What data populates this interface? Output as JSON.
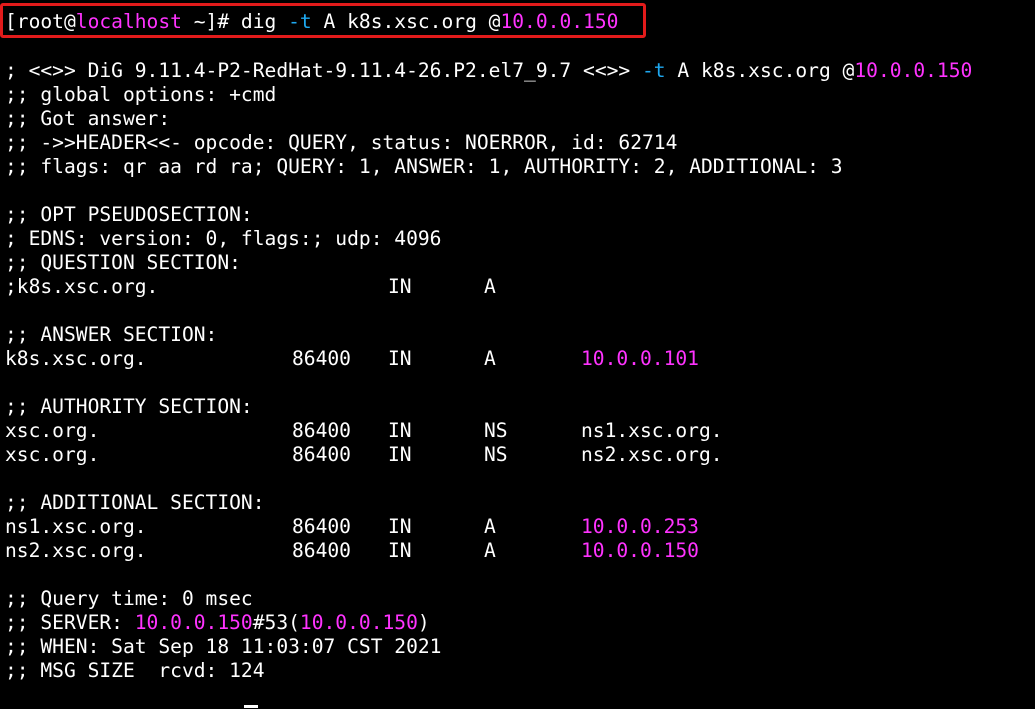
{
  "colors": {
    "background": "#000000",
    "foreground": "#ffffff",
    "magenta": "#ff33ff",
    "cyan": "#1ea8f0",
    "highlight_box": "#e21b1b"
  },
  "prompt": {
    "open": "[root@",
    "host": "localhost",
    "rest": " ~]# dig ",
    "flag": "-t",
    "args": " A k8s.xsc.org @",
    "server": "10.0.0.150"
  },
  "header": {
    "banner_pre": "; <<>> DiG 9.11.4-P2-RedHat-9.11.4-26.P2.el7_9.7 <<>> ",
    "banner_flag": "-t",
    "banner_args": " A k8s.xsc.org @",
    "banner_server": "10.0.0.150",
    "global_options": ";; global options: +cmd",
    "got_answer": ";; Got answer:",
    "header_line": ";; ->>HEADER<<- opcode: QUERY, status: NOERROR, id: 62714",
    "flags_line": ";; flags: qr aa rd ra; QUERY: 1, ANSWER: 1, AUTHORITY: 2, ADDITIONAL: 3"
  },
  "opt": {
    "title": ";; OPT PSEUDOSECTION:",
    "edns": "; EDNS: version: 0, flags:; udp: 4096"
  },
  "question": {
    "title": ";; QUESTION SECTION:",
    "row": {
      "name": ";k8s.xsc.org.",
      "class": "IN",
      "type": "A"
    }
  },
  "answer": {
    "title": ";; ANSWER SECTION:",
    "rows": [
      {
        "name": "k8s.xsc.org.",
        "ttl": "86400",
        "class": "IN",
        "type": "A",
        "data": "10.0.0.101"
      }
    ]
  },
  "authority": {
    "title": ";; AUTHORITY SECTION:",
    "rows": [
      {
        "name": "xsc.org.",
        "ttl": "86400",
        "class": "IN",
        "type": "NS",
        "data": "ns1.xsc.org."
      },
      {
        "name": "xsc.org.",
        "ttl": "86400",
        "class": "IN",
        "type": "NS",
        "data": "ns2.xsc.org."
      }
    ]
  },
  "additional": {
    "title": ";; ADDITIONAL SECTION:",
    "rows": [
      {
        "name": "ns1.xsc.org.",
        "ttl": "86400",
        "class": "IN",
        "type": "A",
        "data": "10.0.0.253"
      },
      {
        "name": "ns2.xsc.org.",
        "ttl": "86400",
        "class": "IN",
        "type": "A",
        "data": "10.0.0.150"
      }
    ]
  },
  "footer": {
    "query_time": ";; Query time: 0 msec",
    "server_label": ";; SERVER: ",
    "server_ip": "10.0.0.150",
    "server_port": "#53(",
    "server_ip2": "10.0.0.150",
    "server_close": ")",
    "when": ";; WHEN: Sat Sep 18 11:03:07 CST 2021",
    "msg_size": ";; MSG SIZE  rcvd: 124"
  }
}
